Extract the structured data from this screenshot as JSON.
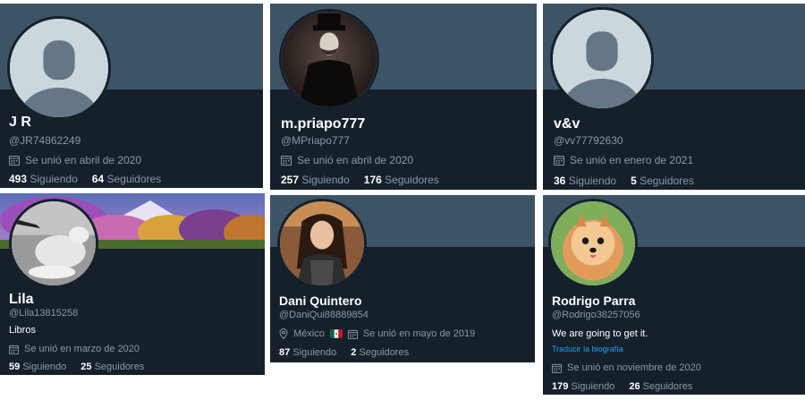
{
  "profiles": [
    {
      "name": "J R",
      "handle": "@JR74862249",
      "joined": "Se unió en abril de 2020",
      "following_count": "493",
      "following_label": "Siguiendo",
      "followers_count": "64",
      "followers_label": "Seguidores",
      "banner_color": "#3d5466",
      "avatar": "default-avatar"
    },
    {
      "name": "m.priapo777",
      "handle": "@MPriapo777",
      "joined": "Se unió en abril de 2020",
      "following_count": "257",
      "following_label": "Siguiendo",
      "followers_count": "176",
      "followers_label": "Seguidores",
      "banner_color": "#3d5466",
      "avatar": "masked-figure-photo"
    },
    {
      "name": "v&v",
      "handle": "@vv77792630",
      "joined": "Se unió en enero de 2021",
      "following_count": "36",
      "following_label": "Siguiendo",
      "followers_count": "5",
      "followers_label": "Seguidores",
      "banner_color": "#3d5466",
      "avatar": "default-avatar"
    },
    {
      "name": "Lila",
      "handle": "@Lila13815258",
      "bio": "Libros",
      "joined": "Se unió en marzo de 2020",
      "following_count": "59",
      "following_label": "Siguiendo",
      "followers_count": "25",
      "followers_label": "Seguidores",
      "banner_color": "#7a5fa0",
      "avatar": "polar-bear-photo"
    },
    {
      "name": "Dani Quintero",
      "handle": "@DaniQui88889854",
      "location": "México",
      "joined": "Se unió en mayo de 2019",
      "following_count": "87",
      "following_label": "Siguiendo",
      "followers_count": "2",
      "followers_label": "Seguidores",
      "banner_color": "#3d5466",
      "avatar": "woman-photo"
    },
    {
      "name": "Rodrigo Parra",
      "handle": "@Rodrigo38257056",
      "bio": "We are going to get it.",
      "translate": "Traducir la biografía",
      "joined": "Se unió en noviembre de 2020",
      "following_count": "179",
      "following_label": "Siguiendo",
      "followers_count": "26",
      "followers_label": "Seguidores",
      "banner_color": "#3d5466",
      "avatar": "pomeranian-dog-photo"
    }
  ],
  "colors": {
    "card_bg": "#15202b",
    "banner": "#3d5466",
    "secondary_text": "#8899a6",
    "link": "#1da1f2"
  }
}
